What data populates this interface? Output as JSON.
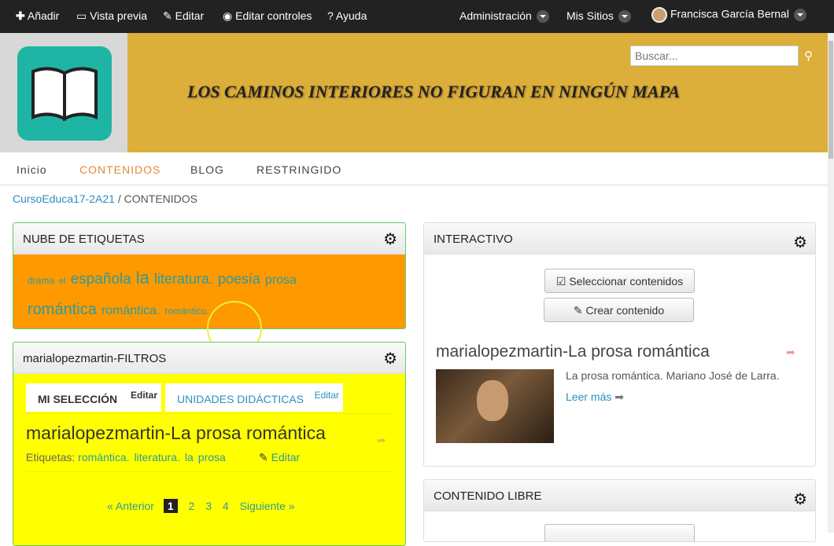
{
  "topbar": {
    "add": "Añadir",
    "preview": "Vista previa",
    "edit": "Editar",
    "edit_controls": "Editar controles",
    "help": "Ayuda",
    "admin": "Administración",
    "my_sites": "Mis Sitios",
    "user": "Francisca García Bernal"
  },
  "banner": {
    "title": "LOS CAMINOS INTERIORES NO FIGURAN EN NINGÚN MAPA",
    "search_placeholder": "Buscar..."
  },
  "nav": [
    "Inicio",
    "CONTENIDOS",
    "BLOG",
    "RESTRINGIDO"
  ],
  "breadcrumb": {
    "site": "CursoEduca17-2A21",
    "current": "CONTENIDOS"
  },
  "tag_cloud": {
    "title": "NUBE DE ETIQUETAS",
    "tags": [
      "drama",
      "el",
      "española",
      "la",
      "literatura.",
      "poesía",
      "prosa",
      "romántica",
      "romántica.",
      "romántico."
    ]
  },
  "filters": {
    "title": "marialopezmartin-FILTROS",
    "tabs": [
      {
        "label": "MI SELECCIÓN",
        "edit": "Editar"
      },
      {
        "label": "UNIDADES DIDÁCTICAS",
        "edit": "Editar"
      }
    ],
    "item_title": "marialopezmartin-La prosa romántica",
    "tags_label": "Etiquetas:",
    "tags": [
      "romántica.",
      "literatura.",
      "la",
      "prosa"
    ],
    "edit": "Editar",
    "pager": {
      "prev": "« Anterior",
      "pages": [
        "1",
        "2",
        "3",
        "4"
      ],
      "current": "1",
      "next": "Siguiente »"
    }
  },
  "interactive": {
    "title": "INTERACTIVO",
    "select": "Seleccionar contenidos",
    "create": "Crear contenido",
    "item_title": "marialopezmartin-La prosa romántica",
    "summary": "La prosa romántica. Mariano José de Larra.",
    "read_more": "Leer más"
  },
  "free": {
    "title": "CONTENIDO LIBRE"
  }
}
